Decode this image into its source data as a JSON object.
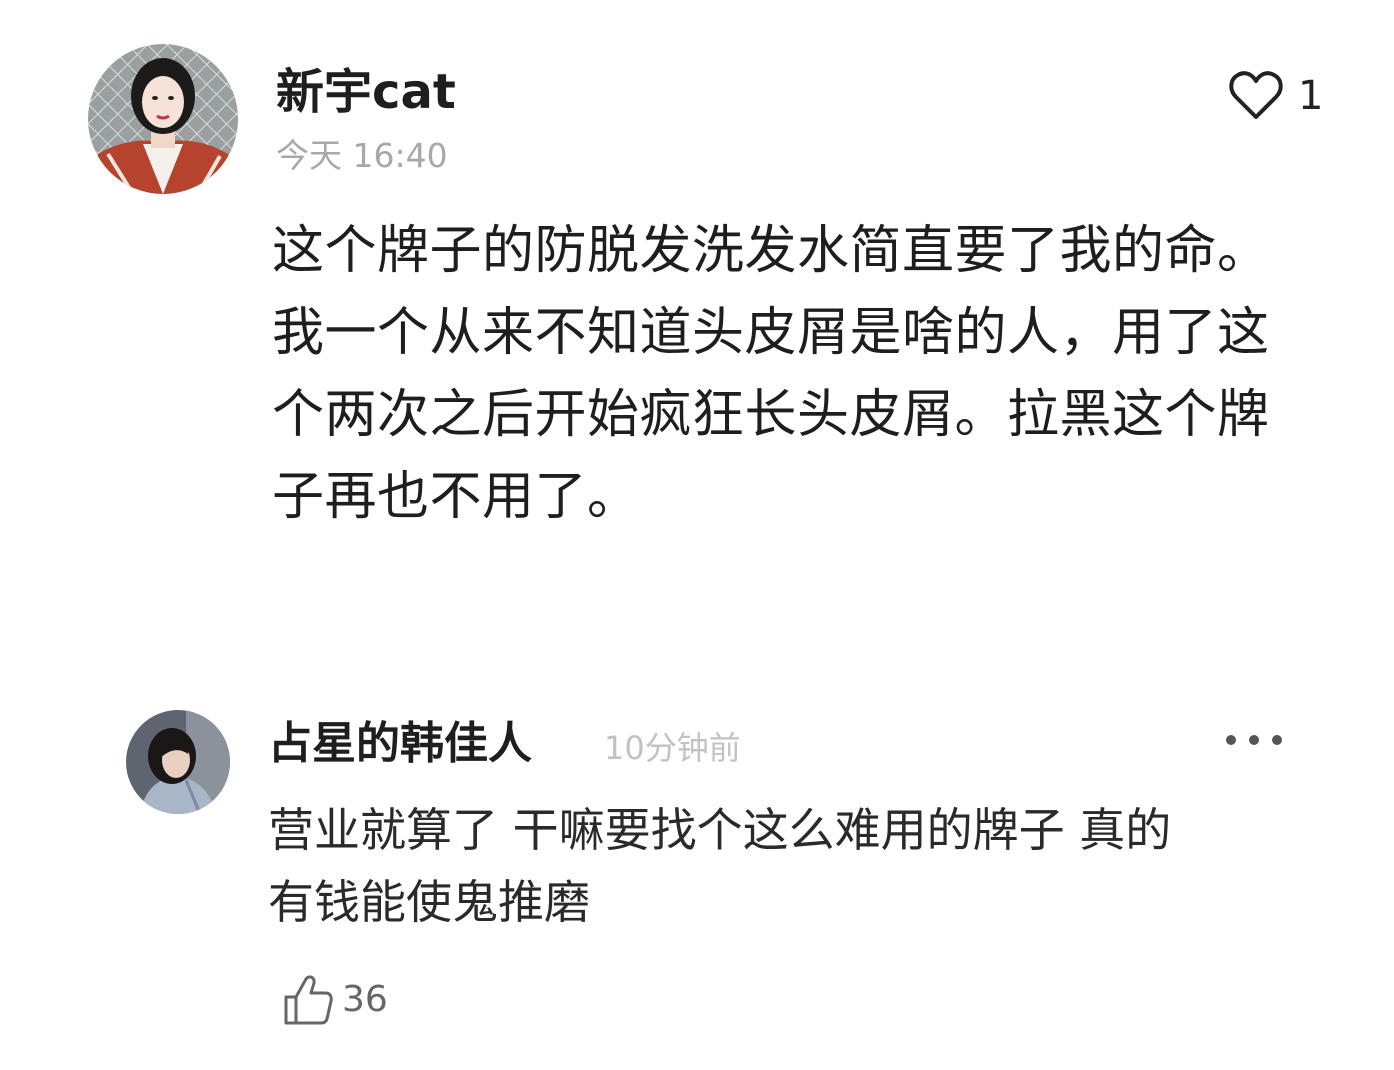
{
  "comments": [
    {
      "username": "新宇cat",
      "timestamp": "今天 16:40",
      "like_count": "1",
      "like_icon": "heart-outline-icon",
      "body_lines": [
        "这个牌子的防脱发洗发水简直要了我的命。",
        "我一个从来不知道头皮屑是啥的人，用了这",
        "个两次之后开始疯狂长头皮屑。拉黑这个牌",
        "子再也不用了。"
      ]
    },
    {
      "username": "占星的韩佳人",
      "timestamp": "10分钟前",
      "more_icon": "more-dots-icon",
      "like_count": "36",
      "like_icon": "thumbs-up-icon",
      "body_lines": [
        "营业就算了 干嘛要找个这么难用的牌子 真的",
        "有钱能使鬼推磨"
      ]
    }
  ]
}
